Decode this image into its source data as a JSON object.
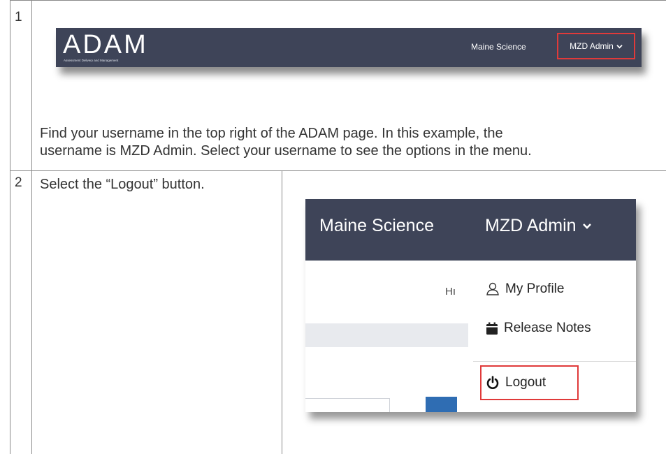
{
  "step1": {
    "number": "1",
    "header": {
      "logo": "ADAM",
      "logo_subtitle": "Assessment Delivery and Management",
      "nav_science": "Maine Science",
      "nav_user": "MZD Admin"
    },
    "instruction_line1": "Find your username in the top right of the ADAM page. In this example, the",
    "instruction_line2": "username is MZD Admin. Select your username to see the options in the menu."
  },
  "step2": {
    "number": "2",
    "instruction": "Select the “Logout” button.",
    "header": {
      "nav_science": "Maine Science",
      "nav_user": "MZD Admin"
    },
    "ghost_text": "Hı",
    "menu": {
      "profile": "My Profile",
      "release_notes": "Release Notes",
      "logout": "Logout"
    }
  },
  "colors": {
    "nav_bar": "#3e4458",
    "highlight_border": "#e03a3a",
    "table_border": "#8a8a8a"
  },
  "icons": [
    "chevron-down-icon",
    "user-icon",
    "calendar-icon",
    "power-icon"
  ]
}
